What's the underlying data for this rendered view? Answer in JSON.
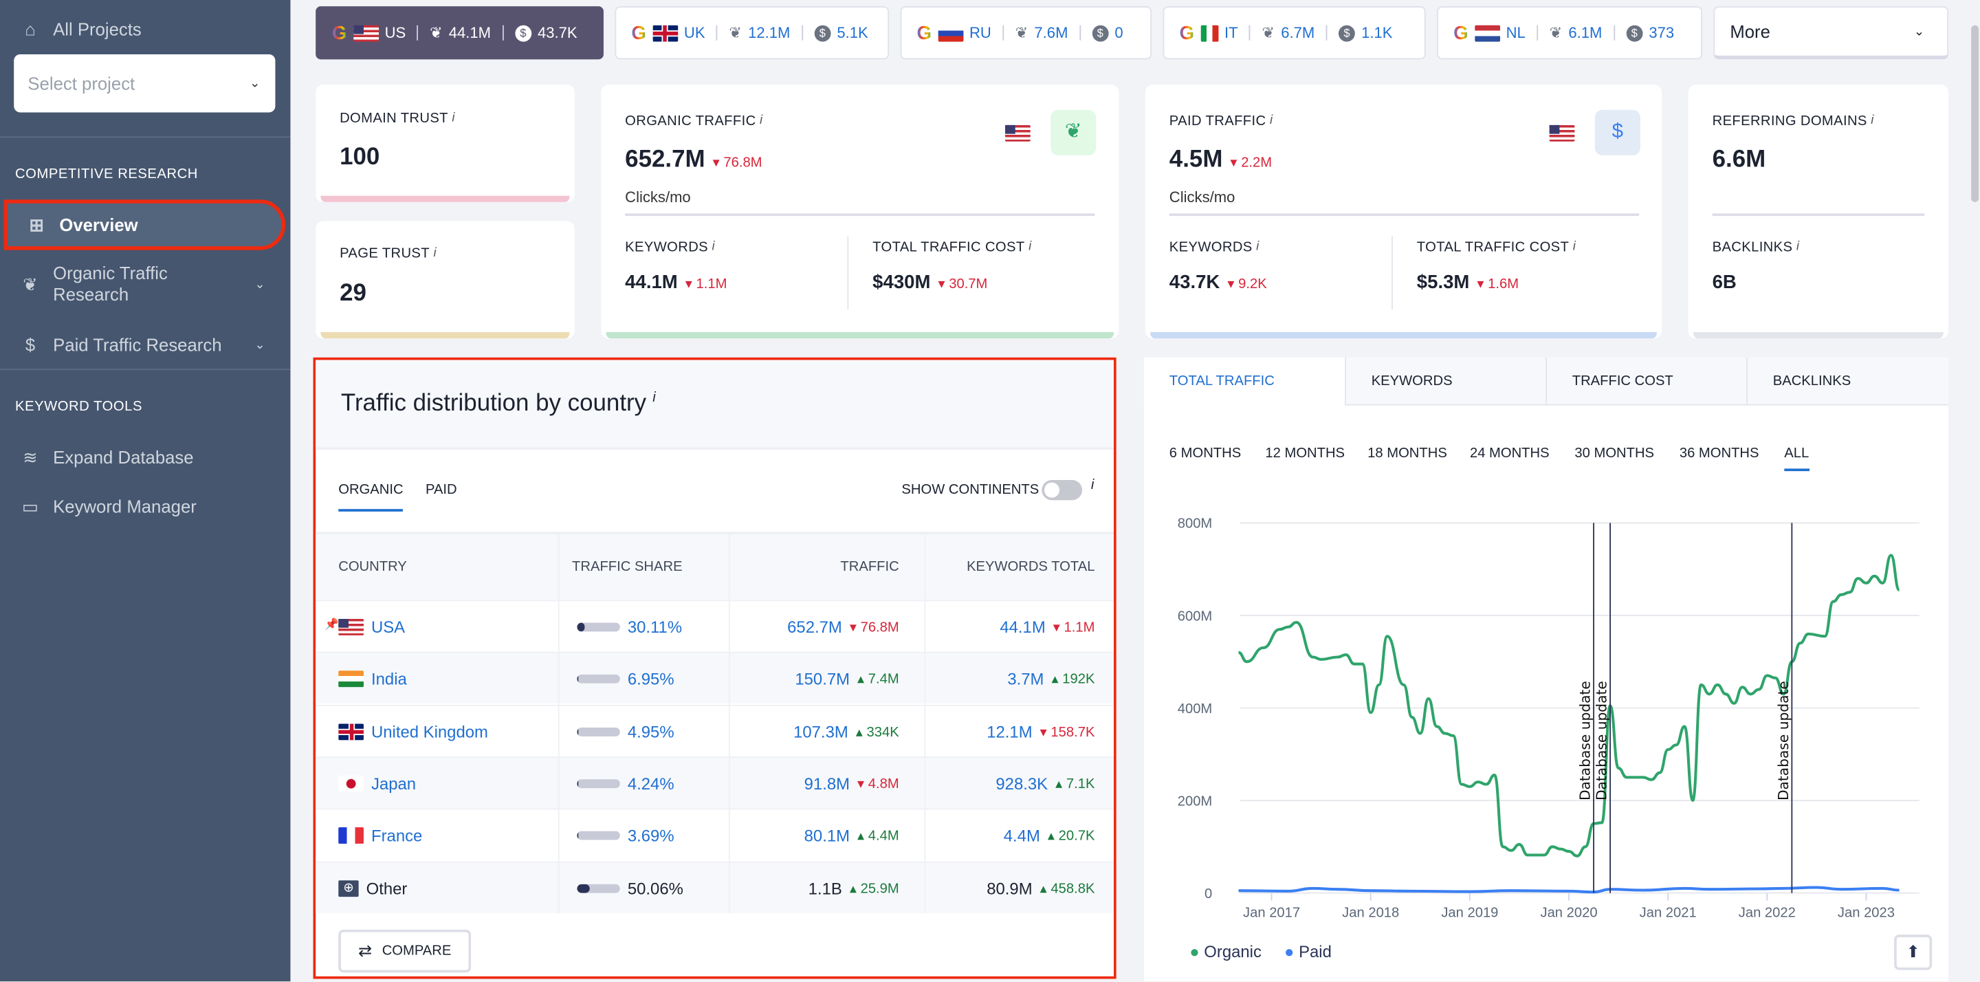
{
  "sidebar": {
    "all_projects": "All Projects",
    "select_placeholder": "Select project",
    "sections": [
      {
        "title": "COMPETITIVE RESEARCH",
        "items": [
          {
            "label": "Overview",
            "icon": "grid-icon",
            "active": true
          },
          {
            "label": "Organic Traffic Research",
            "icon": "leaf-icon"
          },
          {
            "label": "Paid Traffic Research",
            "icon": "dollar-icon"
          }
        ]
      },
      {
        "title": "KEYWORD TOOLS",
        "items": [
          {
            "label": "Expand Database",
            "icon": "database-icon"
          },
          {
            "label": "Keyword Manager",
            "icon": "briefcase-icon"
          }
        ]
      }
    ]
  },
  "db_chips": [
    {
      "country": "US",
      "keywords": "44.1M",
      "paid": "43.7K",
      "active": true
    },
    {
      "country": "UK",
      "keywords": "12.1M",
      "paid": "5.1K"
    },
    {
      "country": "RU",
      "keywords": "7.6M",
      "paid": "0"
    },
    {
      "country": "IT",
      "keywords": "6.7M",
      "paid": "1.1K"
    },
    {
      "country": "NL",
      "keywords": "6.1M",
      "paid": "373"
    }
  ],
  "more_label": "More",
  "cards": {
    "domain_trust": {
      "label": "DOMAIN TRUST",
      "value": "100"
    },
    "page_trust": {
      "label": "PAGE TRUST",
      "value": "29"
    },
    "organic": {
      "label": "ORGANIC TRAFFIC",
      "value": "652.7M",
      "delta": "76.8M",
      "unit": "Clicks/mo",
      "kw_label": "KEYWORDS",
      "kw_value": "44.1M",
      "kw_delta": "1.1M",
      "cost_label": "TOTAL TRAFFIC COST",
      "cost_value": "$430M",
      "cost_delta": "30.7M"
    },
    "paid": {
      "label": "PAID TRAFFIC",
      "value": "4.5M",
      "delta": "2.2M",
      "unit": "Clicks/mo",
      "kw_label": "KEYWORDS",
      "kw_value": "43.7K",
      "kw_delta": "9.2K",
      "cost_label": "TOTAL TRAFFIC COST",
      "cost_value": "$5.3M",
      "cost_delta": "1.6M"
    },
    "referring": {
      "label": "REFERRING DOMAINS",
      "value": "6.6M",
      "bl_label": "BACKLINKS",
      "bl_value": "6B"
    }
  },
  "distribution": {
    "title": "Traffic distribution by country",
    "tabs": [
      "ORGANIC",
      "PAID"
    ],
    "show_continents": "SHOW CONTINENTS",
    "columns": [
      "COUNTRY",
      "TRAFFIC SHARE",
      "TRAFFIC",
      "KEYWORDS TOTAL"
    ],
    "rows": [
      {
        "country": "USA",
        "flag": "us",
        "share": "30.11%",
        "share_frac": 0.3011,
        "traffic": "652.7M",
        "traffic_delta": "76.8M",
        "traffic_dir": "down",
        "keywords": "44.1M",
        "kw_delta": "1.1M",
        "kw_dir": "down",
        "pinned": true
      },
      {
        "country": "India",
        "flag": "in",
        "share": "6.95%",
        "share_frac": 0.0695,
        "traffic": "150.7M",
        "traffic_delta": "7.4M",
        "traffic_dir": "up",
        "keywords": "3.7M",
        "kw_delta": "192K",
        "kw_dir": "up"
      },
      {
        "country": "United Kingdom",
        "flag": "uk",
        "share": "4.95%",
        "share_frac": 0.0495,
        "traffic": "107.3M",
        "traffic_delta": "334K",
        "traffic_dir": "up",
        "keywords": "12.1M",
        "kw_delta": "158.7K",
        "kw_dir": "down"
      },
      {
        "country": "Japan",
        "flag": "jp",
        "share": "4.24%",
        "share_frac": 0.0424,
        "traffic": "91.8M",
        "traffic_delta": "4.8M",
        "traffic_dir": "down",
        "keywords": "928.3K",
        "kw_delta": "7.1K",
        "kw_dir": "up"
      },
      {
        "country": "France",
        "flag": "fr",
        "share": "3.69%",
        "share_frac": 0.0369,
        "traffic": "80.1M",
        "traffic_delta": "4.4M",
        "traffic_dir": "up",
        "keywords": "4.4M",
        "kw_delta": "20.7K",
        "kw_dir": "up"
      },
      {
        "country": "Other",
        "flag": "globe",
        "share": "50.06%",
        "share_frac": 0.5006,
        "traffic": "1.1B",
        "traffic_delta": "25.9M",
        "traffic_dir": "up",
        "keywords": "80.9M",
        "kw_delta": "458.8K",
        "kw_dir": "up"
      }
    ],
    "compare_label": "COMPARE"
  },
  "chart_tabs": [
    "TOTAL TRAFFIC",
    "KEYWORDS",
    "TRAFFIC COST",
    "BACKLINKS"
  ],
  "periods": [
    "6 MONTHS",
    "12 MONTHS",
    "18 MONTHS",
    "24 MONTHS",
    "30 MONTHS",
    "36 MONTHS",
    "ALL"
  ],
  "active_period": "ALL",
  "chart_data": {
    "type": "line",
    "ylim": [
      0,
      800
    ],
    "yticks": [
      "0",
      "200M",
      "400M",
      "600M",
      "800M"
    ],
    "ytick_values": [
      0,
      200,
      400,
      600,
      800
    ],
    "xticks": [
      "Jan 2017",
      "Jan 2018",
      "Jan 2019",
      "Jan 2020",
      "Jan 2021",
      "Jan 2022",
      "Jan 2023"
    ],
    "xtick_dates": [
      "2017-01",
      "2018-01",
      "2019-01",
      "2020-01",
      "2021-01",
      "2022-01",
      "2023-01"
    ],
    "grid": true,
    "legend": "bottom-left",
    "annotations": [
      {
        "date": "2020-04",
        "label": "Database update"
      },
      {
        "date": "2020-06",
        "label": "Database update"
      },
      {
        "date": "2022-04",
        "label": "Database update"
      }
    ],
    "series": [
      {
        "name": "Organic",
        "color": "#2fa46b",
        "points": [
          [
            "2016-09",
            520
          ],
          [
            "2016-10",
            500
          ],
          [
            "2016-12",
            530
          ],
          [
            "2017-02",
            570
          ],
          [
            "2017-03",
            575
          ],
          [
            "2017-04",
            585
          ],
          [
            "2017-06",
            510
          ],
          [
            "2017-07",
            505
          ],
          [
            "2017-09",
            510
          ],
          [
            "2017-10",
            515
          ],
          [
            "2017-11",
            495
          ],
          [
            "2017-12",
            495
          ],
          [
            "2018-01",
            390
          ],
          [
            "2018-02",
            450
          ],
          [
            "2018-03",
            555
          ],
          [
            "2018-05",
            450
          ],
          [
            "2018-06",
            380
          ],
          [
            "2018-07",
            345
          ],
          [
            "2018-08",
            420
          ],
          [
            "2018-09",
            360
          ],
          [
            "2018-10",
            345
          ],
          [
            "2018-11",
            340
          ],
          [
            "2018-12",
            235
          ],
          [
            "2019-01",
            230
          ],
          [
            "2019-02",
            240
          ],
          [
            "2019-03",
            235
          ],
          [
            "2019-04",
            255
          ],
          [
            "2019-05",
            100
          ],
          [
            "2019-06",
            92
          ],
          [
            "2019-07",
            105
          ],
          [
            "2019-08",
            82
          ],
          [
            "2019-10",
            82
          ],
          [
            "2019-11",
            100
          ],
          [
            "2019-12",
            95
          ],
          [
            "2020-01",
            90
          ],
          [
            "2020-02",
            80
          ],
          [
            "2020-03",
            100
          ],
          [
            "2020-04",
            150
          ],
          [
            "2020-05",
            152
          ],
          [
            "2020-06",
            405
          ],
          [
            "2020-07",
            270
          ],
          [
            "2020-08",
            250
          ],
          [
            "2020-10",
            250
          ],
          [
            "2020-11",
            245
          ],
          [
            "2020-12",
            260
          ],
          [
            "2021-01",
            310
          ],
          [
            "2021-02",
            320
          ],
          [
            "2021-03",
            360
          ],
          [
            "2021-04",
            200
          ],
          [
            "2021-05",
            450
          ],
          [
            "2021-06",
            430
          ],
          [
            "2021-07",
            450
          ],
          [
            "2021-08",
            430
          ],
          [
            "2021-09",
            410
          ],
          [
            "2021-10",
            445
          ],
          [
            "2021-11",
            430
          ],
          [
            "2021-12",
            440
          ],
          [
            "2022-01",
            470
          ],
          [
            "2022-02",
            465
          ],
          [
            "2022-03",
            430
          ],
          [
            "2022-04",
            500
          ],
          [
            "2022-05",
            540
          ],
          [
            "2022-06",
            560
          ],
          [
            "2022-08",
            555
          ],
          [
            "2022-09",
            630
          ],
          [
            "2022-10",
            645
          ],
          [
            "2022-11",
            650
          ],
          [
            "2022-12",
            680
          ],
          [
            "2023-01",
            670
          ],
          [
            "2023-02",
            685
          ],
          [
            "2023-03",
            670
          ],
          [
            "2023-04",
            730
          ],
          [
            "2023-05",
            655
          ]
        ]
      },
      {
        "name": "Paid",
        "color": "#3b7ff2",
        "points": [
          [
            "2016-09",
            5
          ],
          [
            "2017-03",
            4
          ],
          [
            "2017-06",
            10
          ],
          [
            "2017-09",
            8
          ],
          [
            "2018-01",
            5
          ],
          [
            "2018-06",
            4
          ],
          [
            "2019-01",
            3
          ],
          [
            "2019-06",
            5
          ],
          [
            "2020-01",
            4
          ],
          [
            "2020-04",
            2
          ],
          [
            "2020-06",
            8
          ],
          [
            "2020-10",
            6
          ],
          [
            "2021-03",
            10
          ],
          [
            "2021-06",
            8
          ],
          [
            "2021-12",
            9
          ],
          [
            "2022-03",
            10
          ],
          [
            "2022-07",
            12
          ],
          [
            "2022-10",
            8
          ],
          [
            "2023-03",
            10
          ],
          [
            "2023-05",
            6
          ]
        ]
      }
    ]
  }
}
